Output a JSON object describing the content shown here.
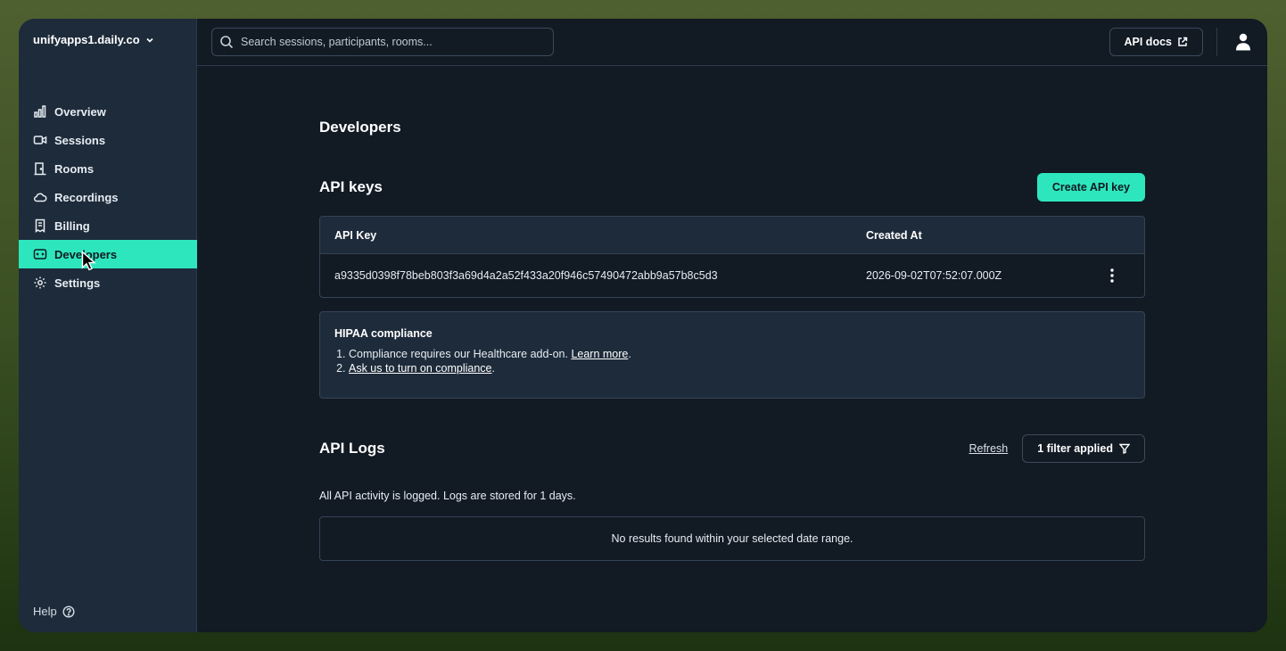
{
  "sidebar": {
    "domain": "unifyapps1.daily.co",
    "items": [
      {
        "label": "Overview",
        "icon": "bar-chart-icon"
      },
      {
        "label": "Sessions",
        "icon": "video-camera-icon"
      },
      {
        "label": "Rooms",
        "icon": "door-icon"
      },
      {
        "label": "Recordings",
        "icon": "cloud-icon"
      },
      {
        "label": "Billing",
        "icon": "receipt-icon"
      },
      {
        "label": "Developers",
        "icon": "code-box-icon",
        "active": true
      },
      {
        "label": "Settings",
        "icon": "gear-icon"
      }
    ],
    "help_label": "Help"
  },
  "topbar": {
    "search_placeholder": "Search sessions, participants, rooms...",
    "api_docs_label": "API docs"
  },
  "page": {
    "title": "Developers",
    "api_keys": {
      "title": "API keys",
      "create_label": "Create API key",
      "columns": [
        "API Key",
        "Created At"
      ],
      "rows": [
        {
          "key": "a9335d0398f78beb803f3a69d4a2a52f433a20f946c57490472abb9a57b8c5d3",
          "created_at": "2026-09-02T07:52:07.000Z"
        }
      ]
    },
    "hipaa": {
      "title": "HIPAA compliance",
      "item1_text": "Compliance requires our Healthcare add-on.",
      "item1_link": "Learn more",
      "item2_link": "Ask us to turn on compliance"
    },
    "api_logs": {
      "title": "API Logs",
      "refresh_label": "Refresh",
      "filter_label": "1 filter applied",
      "subtitle": "All API activity is logged. Logs are stored for 1 days.",
      "empty_text": "No results found within your selected date range."
    }
  },
  "colors": {
    "accent": "#2ee6bd",
    "background": "#121a24",
    "sidebar": "#1e2b3a"
  }
}
